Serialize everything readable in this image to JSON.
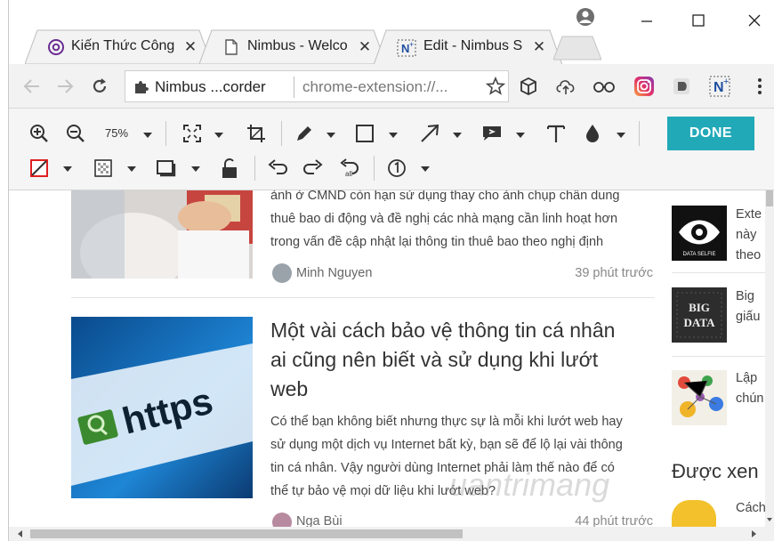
{
  "tabs": [
    {
      "title": "Kiến Thức Công",
      "icon": "at-sign-icon",
      "active": false
    },
    {
      "title": "Nimbus - Welco",
      "icon": "page-icon",
      "active": false
    },
    {
      "title": "Edit - Nimbus S",
      "icon": "nimbus-icon",
      "active": true
    }
  ],
  "window_controls": {
    "profile": "profile-icon",
    "minimize": "minimize-icon",
    "maximize": "maximize-icon",
    "close": "close-icon"
  },
  "address_bar": {
    "site_label": "Nimbus ...corder",
    "url": "chrome-extension://..."
  },
  "editor": {
    "zoom": "75%",
    "done_label": "DONE",
    "colors": {
      "accent": "#22a9b8",
      "stroke": "#e02020"
    }
  },
  "articles": [
    {
      "text_lines": [
        "ảnh ở CMND còn hạn sử dụng thay cho ảnh chụp chân dung",
        "thuê bao di động và đề nghị các nhà mạng cần linh hoạt hơn",
        "trong vấn đề cập nhật lại thông tin thuê bao theo nghị định"
      ],
      "author": "Minh Nguyen",
      "time": "39 phút trước"
    },
    {
      "title_lines": [
        "Một vài cách bảo vệ thông tin cá nhân",
        "ai cũng nên biết và sử dụng khi lướt",
        "web"
      ],
      "text_lines": [
        "Có thể bạn không biết nhưng thực sự là mỗi khi lướt web hay",
        "sử dụng một dịch vụ Internet bất kỳ, bạn sẽ để lộ lại vài thông",
        "tin cá nhân. Vậy người dùng Internet phải làm thế nào để có",
        "thể tự bảo vệ mọi dữ liệu khi lướt web?"
      ],
      "image_text": "https",
      "author": "Nga Bùi",
      "time": "44 phút trước"
    }
  ],
  "sidebar": {
    "items": [
      {
        "lines": [
          "Exte",
          "này",
          "theo"
        ],
        "thumb_text": "DATA SELFIE"
      },
      {
        "lines": [
          "Big",
          "giấu"
        ],
        "thumb_text_1": "BIG",
        "thumb_text_2": "DATA"
      },
      {
        "lines": [
          "Lập",
          "chún"
        ]
      }
    ],
    "section_heading": "Được xen",
    "last_item": "Cách"
  },
  "watermark": "uantrimang"
}
